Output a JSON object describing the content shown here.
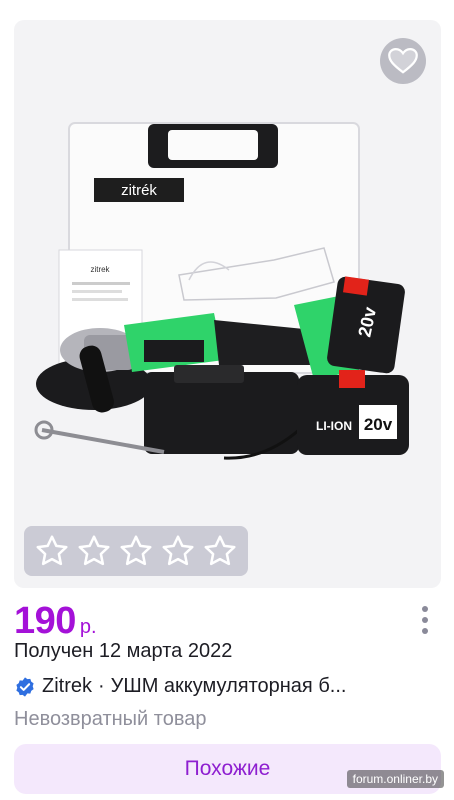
{
  "product": {
    "price": "190",
    "currency": "р.",
    "received": "Получен 12 марта 2022",
    "seller": "Zitrek",
    "separator": "·",
    "title": "УШМ аккумуляторная б...",
    "non_returnable": "Невозвратный товар"
  },
  "image": {
    "brand_box": "zitrék",
    "brand_manual": "zitrek",
    "battery_label": "LI-ION",
    "battery_voltage": "20v"
  },
  "rating": {
    "value": 0,
    "max": 5
  },
  "actions": {
    "similar_label": "Похожие"
  },
  "watermark": "forum.onliner.by",
  "icons": {
    "favorite": "heart-icon",
    "more": "more-vertical-icon",
    "verified": "verified-check-icon",
    "star": "star-outline-icon"
  },
  "colors": {
    "accent": "#a411d8",
    "button_bg": "#f4e8fc",
    "tool_green": "#2fd36a"
  }
}
